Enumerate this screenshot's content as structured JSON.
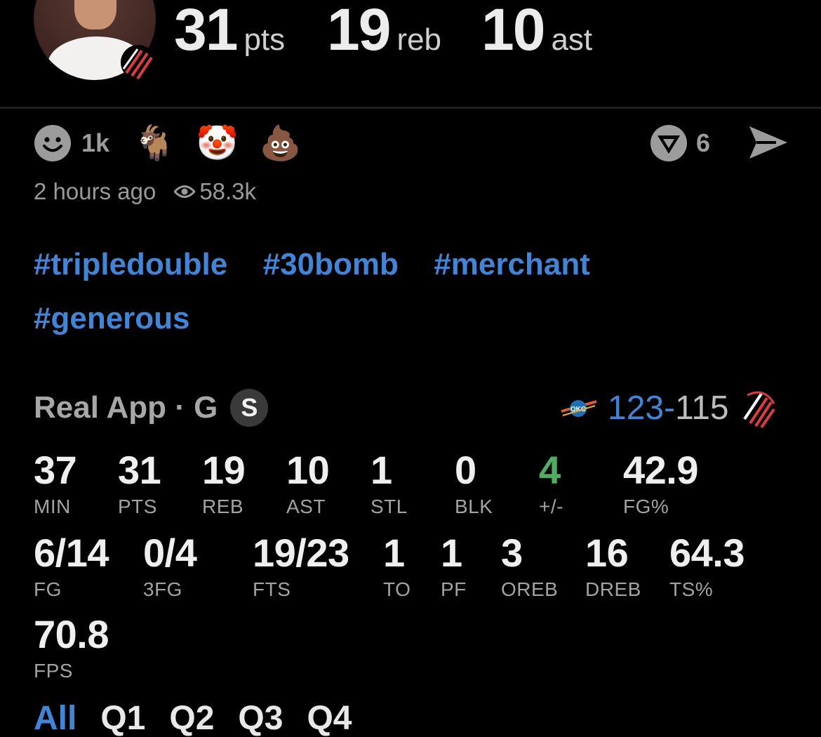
{
  "header": {
    "stats": [
      {
        "value": "31",
        "unit": "pts"
      },
      {
        "value": "19",
        "unit": "reb"
      },
      {
        "value": "10",
        "unit": "ast"
      }
    ]
  },
  "reactions": {
    "primary_count": "1k",
    "emojis": [
      "🐐",
      "🤡",
      "💩"
    ],
    "comment_count": "6"
  },
  "meta": {
    "time": "2 hours ago",
    "views": "58.3k"
  },
  "hashtags": [
    "#tripledouble",
    "#30bomb",
    "#merchant",
    "#generous"
  ],
  "game": {
    "source": "Real App · G",
    "badge": "S",
    "score_a": "123",
    "dash": "-",
    "score_b": "115",
    "team_a_logo": "okc-logo",
    "team_b_logo": "blazers-pinwheel"
  },
  "stats_row1": [
    {
      "value": "37",
      "label": "MIN"
    },
    {
      "value": "31",
      "label": "PTS"
    },
    {
      "value": "19",
      "label": "REB"
    },
    {
      "value": "10",
      "label": "AST"
    },
    {
      "value": "1",
      "label": "STL"
    },
    {
      "value": "0",
      "label": "BLK"
    },
    {
      "value": "4",
      "label": "+/-",
      "color": "#4caf63"
    },
    {
      "value": "42.9",
      "label": "FG%"
    }
  ],
  "stats_row2": [
    {
      "value": "6/14",
      "label": "FG"
    },
    {
      "value": "0/4",
      "label": "3FG"
    },
    {
      "value": "19/23",
      "label": "FTS"
    },
    {
      "value": "1",
      "label": "TO"
    },
    {
      "value": "1",
      "label": "PF"
    },
    {
      "value": "3",
      "label": "OREB"
    },
    {
      "value": "16",
      "label": "DREB"
    },
    {
      "value": "64.3",
      "label": "TS%"
    }
  ],
  "stats_row3": [
    {
      "value": "70.8",
      "label": "FPS"
    }
  ],
  "tabs": [
    "All",
    "Q1",
    "Q2",
    "Q3",
    "Q4"
  ],
  "colors": {
    "accent": "#3f86d9",
    "positive": "#4caf63"
  }
}
